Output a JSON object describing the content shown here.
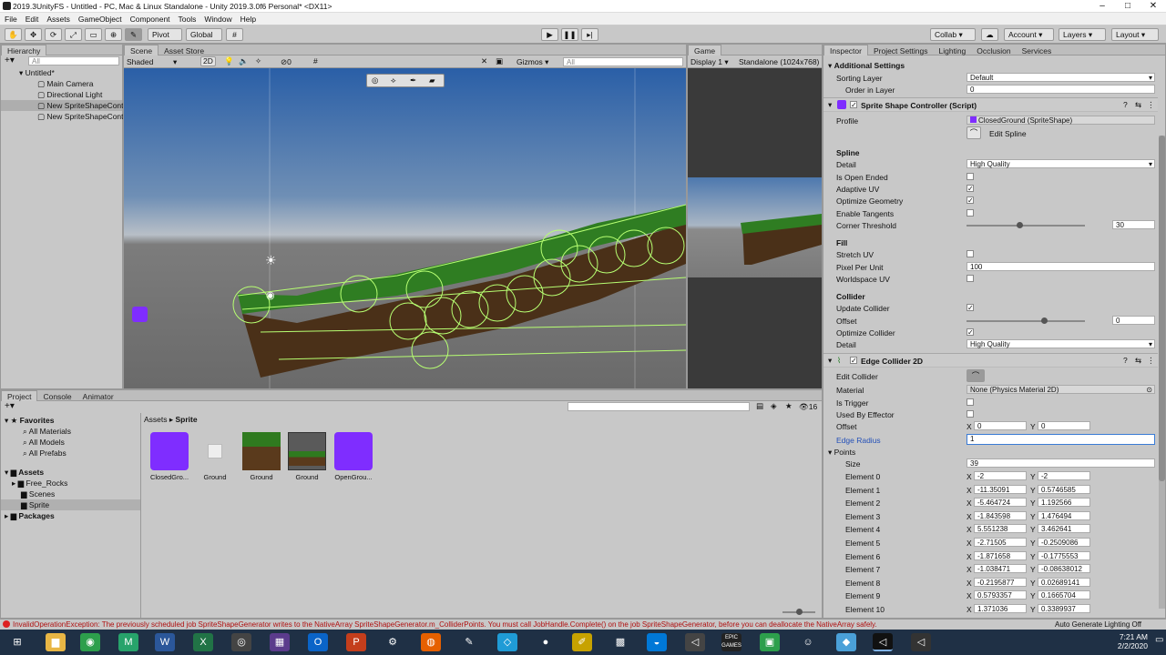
{
  "window": {
    "title": "2019.3UnityFS - Untitled - PC, Mac & Linux Standalone - Unity 2019.3.0f6 Personal* <DX11>"
  },
  "menu": [
    "File",
    "Edit",
    "Assets",
    "GameObject",
    "Component",
    "Tools",
    "Window",
    "Help"
  ],
  "toolbar": {
    "pivot": "Pivot",
    "global": "Global",
    "collab": "Collab",
    "account": "Account",
    "layers": "Layers",
    "layout": "Layout"
  },
  "hierarchy": {
    "tab": "Hierarchy",
    "search_placeholder": "All",
    "scene": "Untitled*",
    "items": [
      "Main Camera",
      "Directional Light",
      "New SpriteShapeCont",
      "New SpriteShapeCont"
    ]
  },
  "scene": {
    "tabs": [
      "Scene",
      "Asset Store"
    ],
    "shading": "Shaded",
    "mode": "2D",
    "gizmos_count": "0",
    "gizmos": "Gizmos",
    "search_placeholder": "All"
  },
  "game": {
    "tab": "Game",
    "display": "Display 1",
    "resolution": "Standalone (1024x768)"
  },
  "inspector": {
    "tabs": [
      "Inspector",
      "Project Settings",
      "Lighting",
      "Occlusion",
      "Services"
    ],
    "additional_settings": {
      "header": "Additional Settings",
      "sorting_layer_label": "Sorting Layer",
      "sorting_layer": "Default",
      "order_label": "Order in Layer",
      "order": "0"
    },
    "sprite_shape": {
      "header": "Sprite Shape Controller (Script)",
      "profile_label": "Profile",
      "profile": "ClosedGround (SpriteShape)",
      "edit_spline": "Edit Spline",
      "spline_header": "Spline",
      "detail_label": "Detail",
      "detail": "High Quality",
      "is_open_ended": "Is Open Ended",
      "adaptive_uv": "Adaptive UV",
      "optimize_geometry": "Optimize Geometry",
      "enable_tangents": "Enable Tangents",
      "corner_threshold_label": "Corner Threshold",
      "corner_threshold": "30",
      "fill_header": "Fill",
      "stretch_uv": "Stretch UV",
      "pixel_per_unit_label": "Pixel Per Unit",
      "pixel_per_unit": "100",
      "worldspace_uv": "Worldspace UV",
      "collider_header": "Collider",
      "update_collider": "Update Collider",
      "offset_label": "Offset",
      "offset": "0",
      "optimize_collider": "Optimize Collider",
      "collider_detail_label": "Detail",
      "collider_detail": "High Quality",
      "checks": {
        "is_open_ended": false,
        "adaptive_uv": true,
        "optimize_geometry": true,
        "enable_tangents": false,
        "stretch_uv": false,
        "worldspace_uv": false,
        "update_collider": true,
        "optimize_collider": true
      }
    },
    "edge_collider": {
      "header": "Edge Collider 2D",
      "edit_collider": "Edit Collider",
      "material_label": "Material",
      "material": "None (Physics Material 2D)",
      "is_trigger": "Is Trigger",
      "used_by_effector": "Used By Effector",
      "offset_label": "Offset",
      "offset_x": "0",
      "offset_y": "0",
      "edge_radius_label": "Edge Radius",
      "edge_radius": "1",
      "points_label": "Points",
      "size_label": "Size",
      "size": "39",
      "elements": [
        {
          "label": "Element 0",
          "x": "-2",
          "y": "-2"
        },
        {
          "label": "Element 1",
          "x": "-11.35091",
          "y": "0.5746585"
        },
        {
          "label": "Element 2",
          "x": "-5.464724",
          "y": "1.192566"
        },
        {
          "label": "Element 3",
          "x": "-1.843598",
          "y": "1.476494"
        },
        {
          "label": "Element 4",
          "x": "5.551238",
          "y": "3.462641"
        },
        {
          "label": "Element 5",
          "x": "-2.71505",
          "y": "-0.2509086"
        },
        {
          "label": "Element 6",
          "x": "-1.871658",
          "y": "-0.1775553"
        },
        {
          "label": "Element 7",
          "x": "-1.038471",
          "y": "-0.08638012"
        },
        {
          "label": "Element 8",
          "x": "-0.2195877",
          "y": "0.02689141"
        },
        {
          "label": "Element 9",
          "x": "0.5793357",
          "y": "0.1665704"
        },
        {
          "label": "Element 10",
          "x": "1.371036",
          "y": "0.3389937"
        }
      ]
    }
  },
  "project": {
    "tabs": [
      "Project",
      "Console",
      "Animator"
    ],
    "count": "16",
    "favorites": {
      "header": "Favorites",
      "items": [
        "All Materials",
        "All Models",
        "All Prefabs"
      ]
    },
    "assets": {
      "header": "Assets",
      "items": [
        "Free_Rocks",
        "Scenes",
        "Sprite"
      ]
    },
    "packages": "Packages",
    "breadcrumb": [
      "Assets",
      "Sprite"
    ],
    "files": [
      "ClosedGro...",
      "Ground",
      "Ground",
      "Ground",
      "OpenGrou..."
    ]
  },
  "status": {
    "error": "InvalidOperationException: The previously scheduled job SpriteShapeGenerator writes to the NativeArray SpriteShapeGenerator.m_ColliderPoints. You must call JobHandle.Complete() on the job SpriteShapeGenerator, before you can deallocate the NativeArray safely.",
    "lighting": "Auto Generate Lighting Off"
  },
  "taskbar": {
    "time": "7:21 AM",
    "date": "2/2/2020",
    "epic": "EPIC GAMES"
  }
}
